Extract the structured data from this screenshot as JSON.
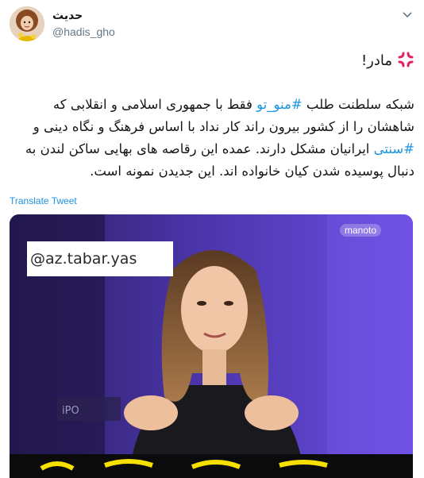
{
  "author": {
    "display_name": "حدیث",
    "handle": "@hadis_gho"
  },
  "icons": {
    "caret": "chevron-down-icon",
    "reaction": "anger-symbol-icon"
  },
  "tweet": {
    "line0": "مادر!",
    "line1_a": "شبکه سلطنت طلب ",
    "hashtag1": "#منو_تو",
    "line1_b": " فقط با جمهوری اسلامی و انقلابی که",
    "line2": "شاهشان را از کشور بیرون راند کار نداد با اساس فرهنگ و نگاه دینی و",
    "hashtag2": "#سنتی",
    "line3_b": " ایرانیان مشکل دارند. عمده این رقاصه های بهایی ساکن لندن به",
    "line4": "دنبال پوسیده شدن کیان خانواده اند. این جدیدن نمونه است."
  },
  "translate_label": "Translate Tweet",
  "media": {
    "watermark": "@az.tabar.yas",
    "channel_logo": "manoto"
  },
  "colors": {
    "link": "#1b95e0",
    "text": "#14171a",
    "secondary": "#657786",
    "studio_purple": "#5b3fc4"
  }
}
